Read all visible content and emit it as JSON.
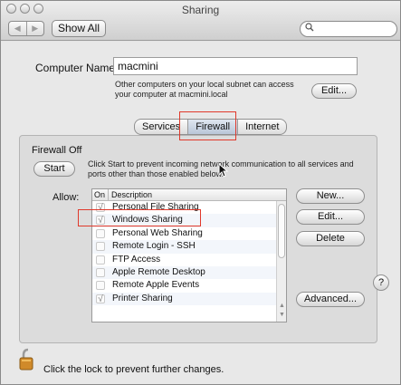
{
  "window": {
    "title": "Sharing"
  },
  "toolbar": {
    "back_icon": "◀",
    "forward_icon": "▶",
    "show_all": "Show All",
    "search_placeholder": ""
  },
  "computer_name": {
    "label": "Computer Name:",
    "value": "macmini",
    "help": "Other computers on your local subnet can access your computer at macmini.local",
    "edit_button": "Edit..."
  },
  "tabs": [
    "Services",
    "Firewall",
    "Internet"
  ],
  "firewall": {
    "status": "Firewall Off",
    "start_button": "Start",
    "start_help": "Click Start to prevent incoming network communication to all services and ports other than those enabled below.",
    "allow_label": "Allow:",
    "columns": {
      "on": "On",
      "description": "Description"
    },
    "items": [
      {
        "label": "Personal File Sharing",
        "mark": "√"
      },
      {
        "label": "Windows Sharing",
        "mark": "√"
      },
      {
        "label": "Personal Web Sharing",
        "mark": ""
      },
      {
        "label": "Remote Login - SSH",
        "mark": ""
      },
      {
        "label": "FTP Access",
        "mark": ""
      },
      {
        "label": "Apple Remote Desktop",
        "mark": ""
      },
      {
        "label": "Remote Apple Events",
        "mark": ""
      },
      {
        "label": "Printer Sharing",
        "mark": "√"
      }
    ],
    "new_button": "New...",
    "edit_button": "Edit...",
    "delete_button": "Delete",
    "advanced_button": "Advanced..."
  },
  "help_button": "?",
  "lock_text": "Click the lock to prevent further changes.",
  "colors": {
    "annotation": "#e0392b",
    "lock": "#d08a2a"
  }
}
